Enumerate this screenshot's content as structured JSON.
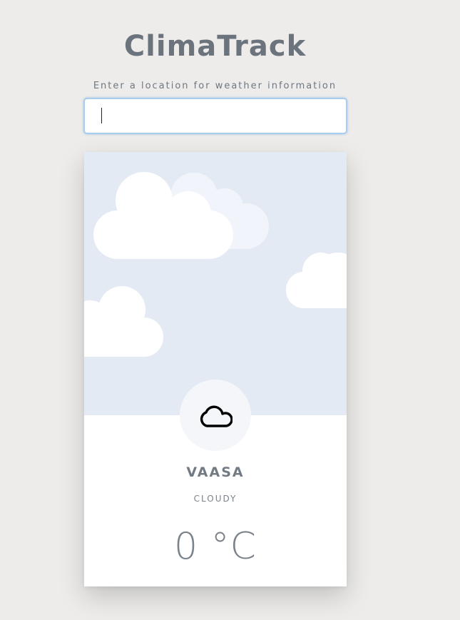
{
  "header": {
    "title": "ClimaTrack",
    "prompt": "Enter a location for weather information"
  },
  "search": {
    "value": "",
    "placeholder": ""
  },
  "weather": {
    "city": "VAASA",
    "condition": "CLOUDY",
    "temperature": "0 °C",
    "icon": "cloud-icon"
  },
  "colors": {
    "background": "#edecea",
    "sky": "#e4eaf4",
    "card": "#ffffff",
    "text": "#6b737c",
    "input_border": "#a8cdee"
  }
}
